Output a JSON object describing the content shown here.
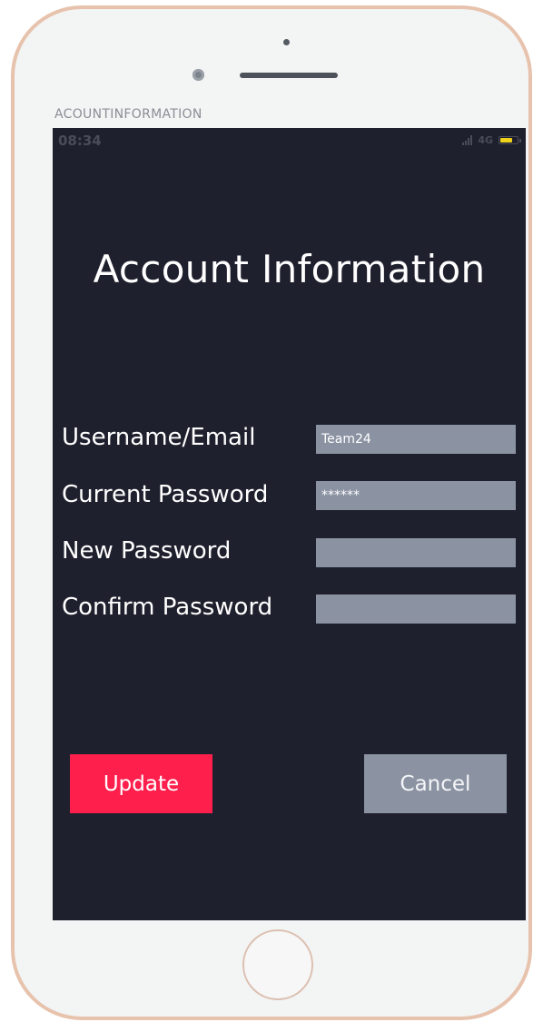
{
  "frame_caption": "ACOUNTINFORMATION",
  "status_bar": {
    "time": "08:34",
    "network": "4G",
    "battery_color": "#f0d21a"
  },
  "page": {
    "title": "Account Information"
  },
  "form": {
    "fields": [
      {
        "label": "Username/Email",
        "value": "Team24",
        "placeholder": ""
      },
      {
        "label": "Current Password",
        "value": "******",
        "placeholder": ""
      },
      {
        "label": "New Password",
        "value": "",
        "placeholder": ""
      },
      {
        "label": "Confirm Password",
        "value": "",
        "placeholder": ""
      }
    ]
  },
  "actions": {
    "update_label": "Update",
    "cancel_label": "Cancel"
  },
  "colors": {
    "screen_background": "#1f202d",
    "input_background": "#8b93a3",
    "update_button": "#fe1f4d",
    "cancel_button": "#8b93a3",
    "phone_frame": "#e7c3ad"
  }
}
